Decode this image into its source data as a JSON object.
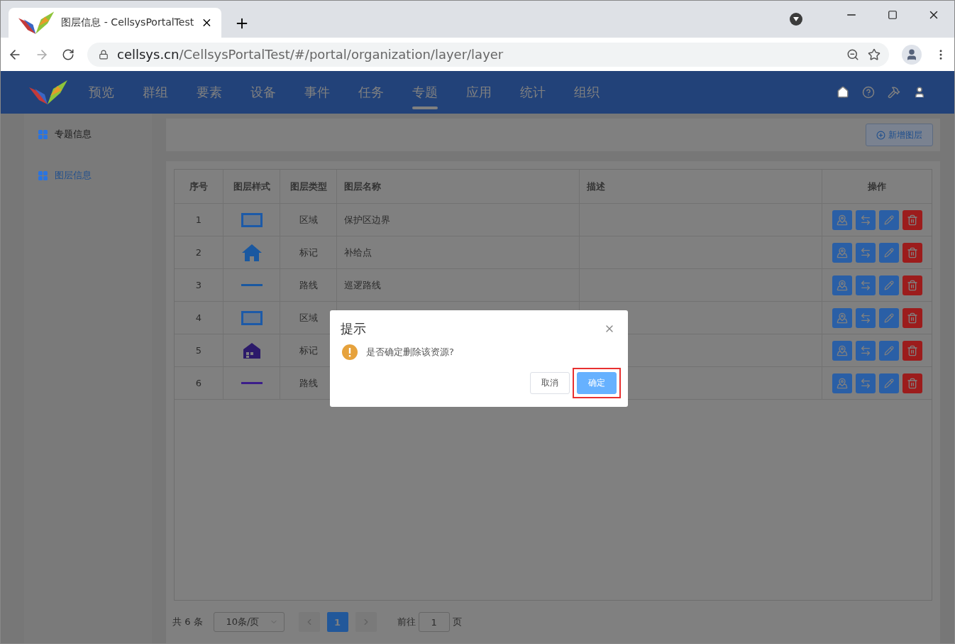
{
  "browser": {
    "tab_title": "图层信息 - CellsysPortalTest",
    "url_host": "cellsys.cn",
    "url_path": "/CellsysPortalTest/#/portal/organization/layer/layer"
  },
  "nav": {
    "items": [
      {
        "label": "预览",
        "selected": false
      },
      {
        "label": "群组",
        "selected": false
      },
      {
        "label": "要素",
        "selected": false
      },
      {
        "label": "设备",
        "selected": false
      },
      {
        "label": "事件",
        "selected": false
      },
      {
        "label": "任务",
        "selected": false
      },
      {
        "label": "专题",
        "selected": true
      },
      {
        "label": "应用",
        "selected": false
      },
      {
        "label": "统计",
        "selected": false
      },
      {
        "label": "组织",
        "selected": false
      }
    ]
  },
  "sidebar": {
    "items": [
      {
        "label": "专题信息",
        "selected": false
      },
      {
        "label": "图层信息",
        "selected": true
      }
    ]
  },
  "toolbar": {
    "add_button": "新增图层"
  },
  "table": {
    "columns": [
      "序号",
      "图层样式",
      "图层类型",
      "图层名称",
      "描述",
      "操作"
    ],
    "rows": [
      {
        "index": "1",
        "style": {
          "kind": "area",
          "color": "#1c5aa8"
        },
        "type": "区域",
        "name": "保护区边界"
      },
      {
        "index": "2",
        "style": {
          "kind": "house",
          "color": "#1a58a0"
        },
        "type": "标记",
        "name": "补给点"
      },
      {
        "index": "3",
        "style": {
          "kind": "line",
          "color": "#1a58a0"
        },
        "type": "路线",
        "name": "巡逻路线"
      },
      {
        "index": "4",
        "style": {
          "kind": "area",
          "color": "#1c5aa8"
        },
        "type": "区域"
      },
      {
        "index": "5",
        "style": {
          "kind": "building",
          "color": "#2c1a6a"
        },
        "type": "标记"
      },
      {
        "index": "6",
        "style": {
          "kind": "line",
          "color": "#3c1e8a"
        },
        "type": "路线"
      }
    ]
  },
  "pagination": {
    "total": "共 6 条",
    "page_size": "10条/页",
    "pages": [
      {
        "label": "1",
        "selected": true
      }
    ],
    "goto_label": "前往",
    "goto_value": "1",
    "goto_suffix": "页"
  },
  "dialog": {
    "title": "提示",
    "message": "是否确定删除该资源?",
    "buttons": [
      {
        "label": "取消",
        "kind": "default",
        "highlighted": false
      },
      {
        "label": "确定",
        "kind": "primary",
        "highlighted": true
      }
    ]
  }
}
